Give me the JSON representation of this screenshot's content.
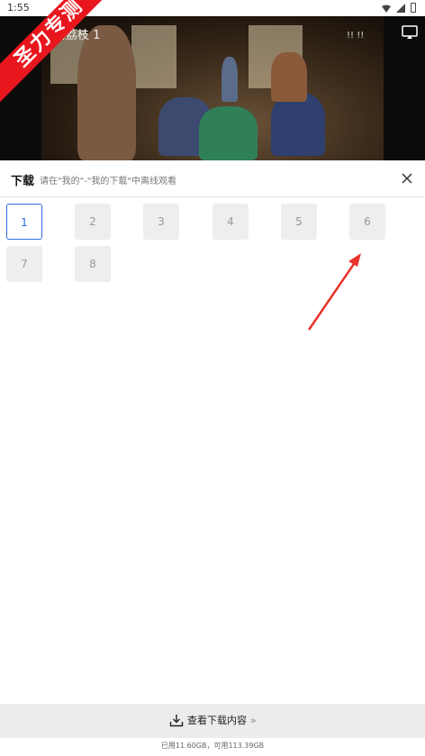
{
  "status_bar": {
    "time": "1:55"
  },
  "promo": {
    "ribbon_text": "圣力专测"
  },
  "video": {
    "title": "的荔枝 1",
    "overlay_text": "!! !!"
  },
  "download_panel": {
    "title": "下载",
    "hint": "请在\"我的\"-\"我的下载\"中离线观看",
    "selected_episode": "1",
    "episodes": [
      "1",
      "2",
      "3",
      "4",
      "5",
      "6",
      "7",
      "8"
    ]
  },
  "footer": {
    "view_downloads_label": "查看下载内容",
    "chevron": "»",
    "storage_text": "已用11.60GB，可用113.39GB"
  },
  "colors": {
    "accent": "#2a6fdb",
    "ribbon": "#e8161d",
    "arrow": "#e8332a"
  }
}
